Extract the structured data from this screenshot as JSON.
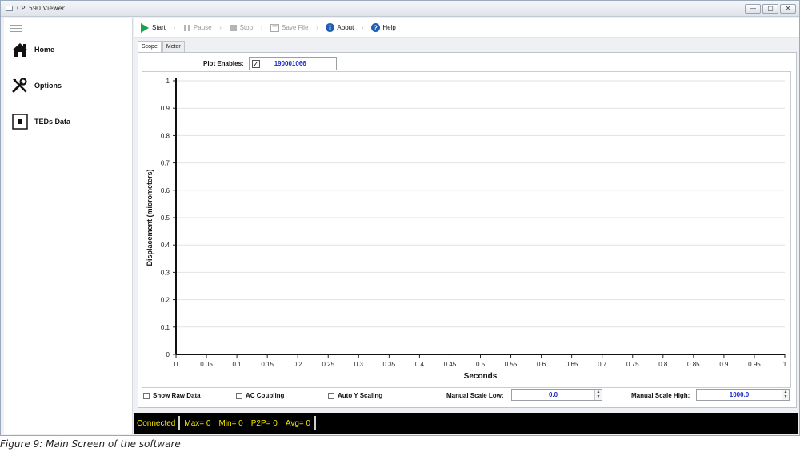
{
  "window": {
    "title": "CPL590 Viewer",
    "controls": [
      "—",
      "▢",
      "✕"
    ]
  },
  "sidebar": {
    "items": [
      {
        "label": "Home",
        "icon": "home-icon"
      },
      {
        "label": "Options",
        "icon": "tools-icon"
      },
      {
        "label": "TEDs Data",
        "icon": "chip-icon"
      }
    ]
  },
  "toolbar": {
    "start": "Start",
    "pause": "Pause",
    "stop": "Stop",
    "save_file": "Save File",
    "about": "About",
    "help": "Help"
  },
  "tabs": [
    {
      "label": "Scope",
      "active": true
    },
    {
      "label": "Meter",
      "active": false
    }
  ],
  "plot_enables": {
    "label": "Plot Enables:",
    "checked": true,
    "check_glyph": "✓",
    "value": "190001066"
  },
  "chart_data": {
    "type": "line",
    "xlabel": "Seconds",
    "ylabel": "Displacement (micrometers)",
    "xlim": [
      0,
      1
    ],
    "ylim": [
      0,
      1
    ],
    "xticks": [
      "0",
      "0.05",
      "0.1",
      "0.15",
      "0.2",
      "0.25",
      "0.3",
      "0.35",
      "0.4",
      "0.45",
      "0.5",
      "0.55",
      "0.6",
      "0.65",
      "0.7",
      "0.75",
      "0.8",
      "0.85",
      "0.9",
      "0.95",
      "1"
    ],
    "yticks": [
      "0",
      "0.1",
      "0.2",
      "0.3",
      "0.4",
      "0.5",
      "0.6",
      "0.7",
      "0.8",
      "0.9",
      "1"
    ],
    "grid": true,
    "series": []
  },
  "options": {
    "show_raw_data": "Show Raw Data",
    "ac_coupling": "AC Coupling",
    "auto_y_scaling": "Auto Y Scaling",
    "manual_scale_low_label": "Manual Scale Low:",
    "manual_scale_low_value": "0.0",
    "manual_scale_high_label": "Manual Scale High:",
    "manual_scale_high_value": "1000.0"
  },
  "status": {
    "state": "Connected",
    "max": "Max= 0",
    "min": "Min= 0",
    "p2p": "P2P= 0",
    "avg": "Avg= 0"
  },
  "caption": "Figure 9: Main Screen of the software",
  "colors": {
    "status_text": "#f3e600",
    "value_text": "#1f2ac8",
    "start_icon": "#1aa34a",
    "info_icon": "#1e5fb4"
  }
}
